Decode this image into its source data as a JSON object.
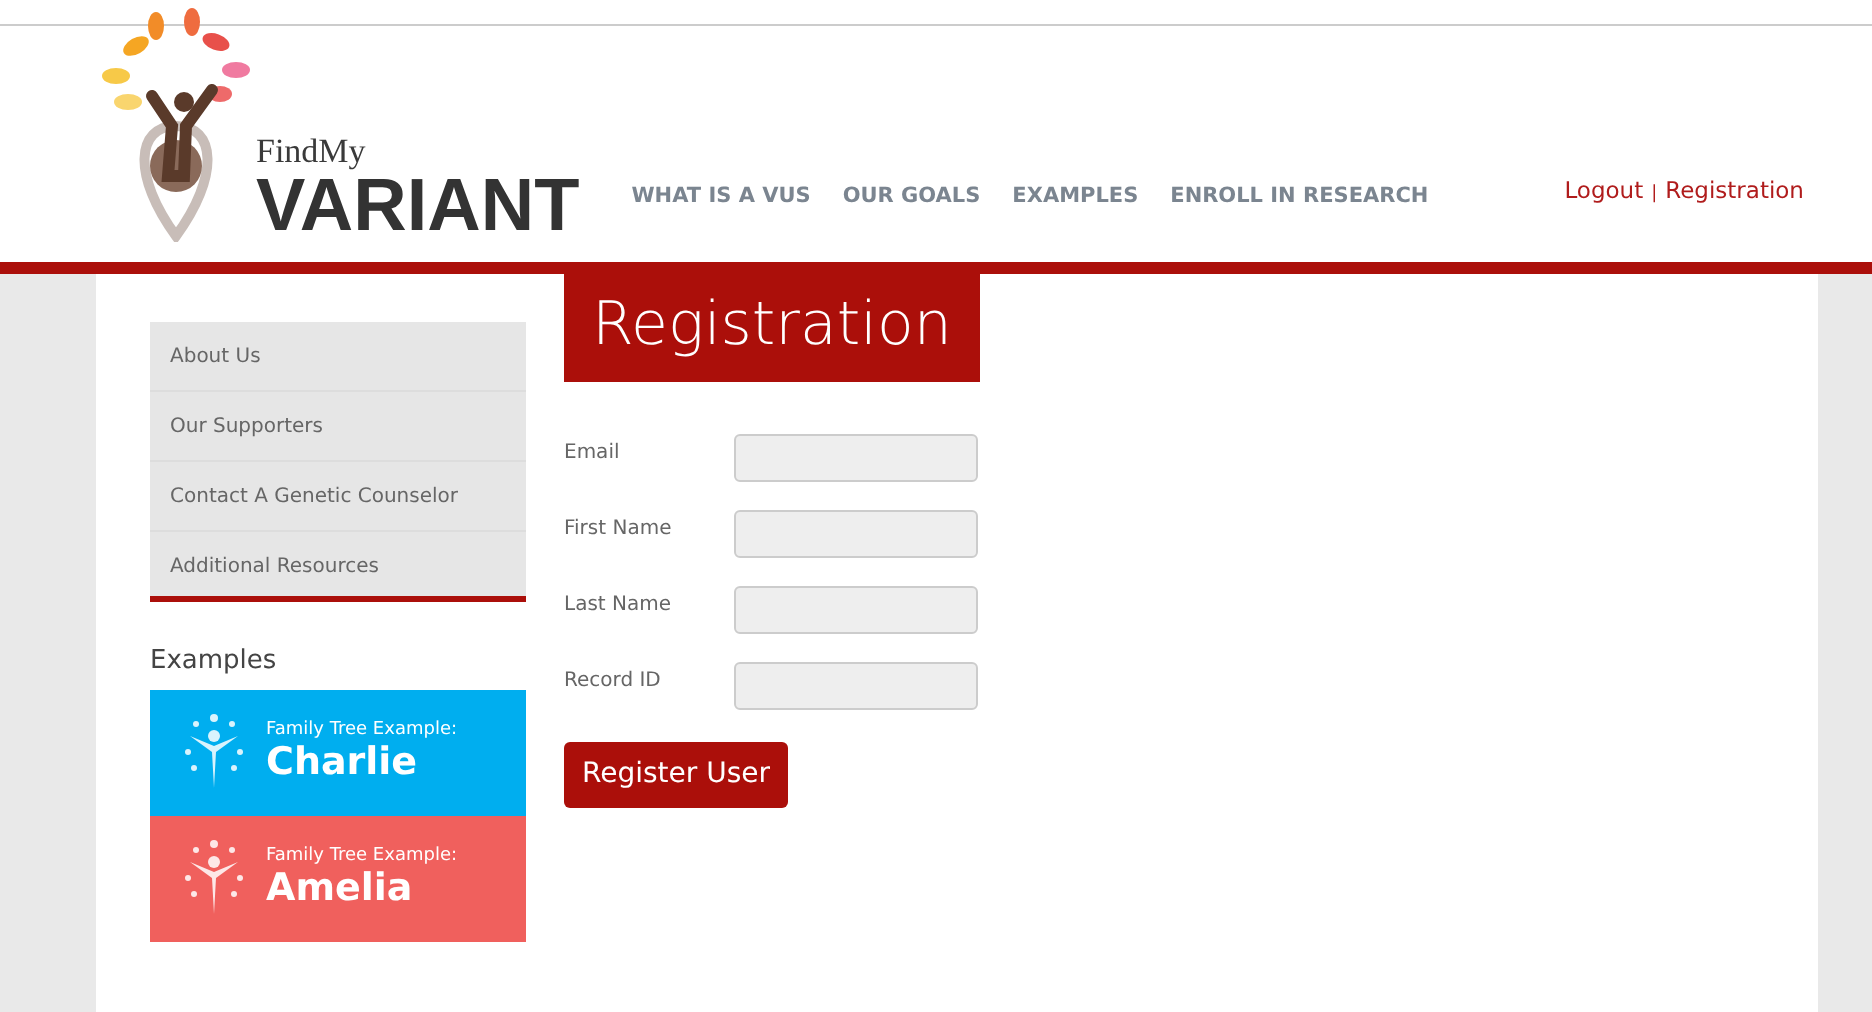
{
  "logo": {
    "small": "FindMy",
    "big": "VARIANT"
  },
  "nav": [
    "WHAT IS A VUS",
    "OUR GOALS",
    "EXAMPLES",
    "ENROLL IN RESEARCH"
  ],
  "account_links": {
    "logout": "Logout",
    "separator": "|",
    "register": "Registration"
  },
  "sidebar": {
    "items": [
      "About Us",
      "Our Supporters",
      "Contact A Genetic Counselor",
      "Additional Resources"
    ],
    "examples_heading": "Examples",
    "examples": [
      {
        "caption": "Family Tree Example:",
        "name": "Charlie",
        "color": "#00aeef"
      },
      {
        "caption": "Family Tree Example:",
        "name": "Amelia",
        "color": "#f0605d"
      }
    ]
  },
  "page_title": "Registration",
  "form": {
    "fields": [
      {
        "label": "Email"
      },
      {
        "label": "First Name"
      },
      {
        "label": "Last Name"
      },
      {
        "label": "Record ID"
      }
    ],
    "submit": "Register User"
  }
}
